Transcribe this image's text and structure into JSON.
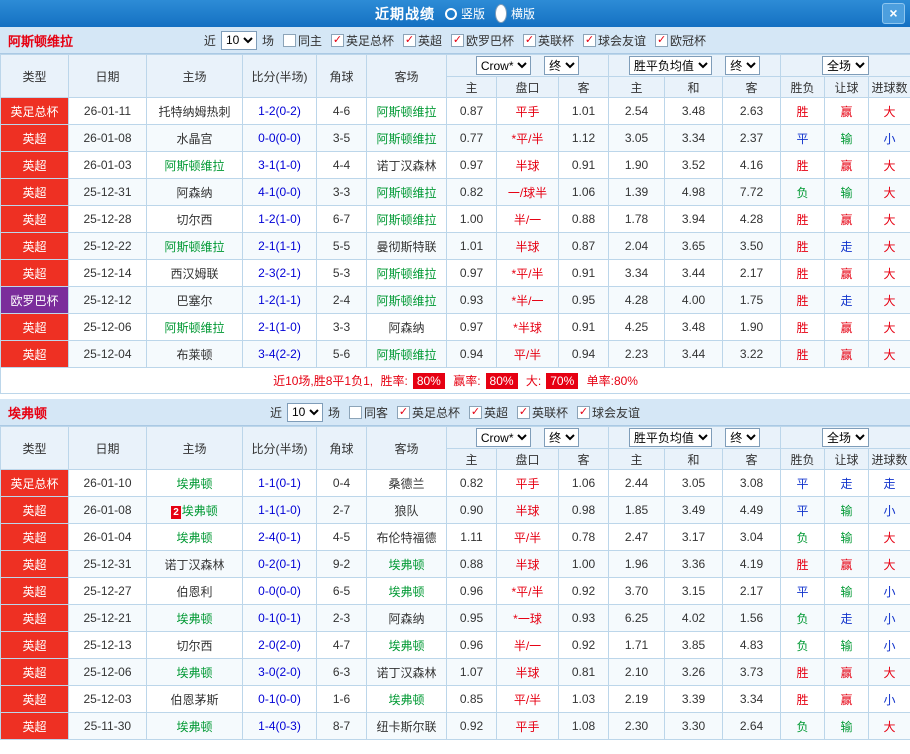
{
  "topbar": {
    "title": "近期战绩",
    "vertical": "竖版",
    "horizontal": "横版",
    "close": "×"
  },
  "controls": {
    "near": "近",
    "count": "10",
    "games": "场",
    "company": "Crow*",
    "final": "终",
    "avg": "胜平负均值",
    "scope": "全场"
  },
  "table_columns": {
    "type": "类型",
    "date": "日期",
    "home": "主场",
    "score": "比分(半场)",
    "corner": "角球",
    "away": "客场",
    "sub": [
      "主",
      "盘口",
      "客",
      "主",
      "和",
      "客",
      "胜负",
      "让球",
      "进球数"
    ]
  },
  "colors": {
    "topbar_blue": "#1470c2",
    "header_blue": "#d5e7f6",
    "accent_red": "#e60012"
  },
  "league_colors": {
    "英超": "#ee3023",
    "英足总杯": "#ee3023",
    "欧罗巴杯": "#7b2d9b"
  },
  "result_colors": {
    "胜": "#e60012",
    "平": "#1133cc",
    "负": "#009933",
    "赢": "#e60012",
    "输": "#009933",
    "走": "#1133cc",
    "大": "#e60012",
    "小": "#1133cc"
  },
  "sections": [
    {
      "team": "阿斯顿维拉",
      "filters": [
        {
          "label": "同主",
          "checked": false
        },
        {
          "label": "英足总杯",
          "checked": true
        },
        {
          "label": "英超",
          "checked": true
        },
        {
          "label": "欧罗巴杯",
          "checked": true
        },
        {
          "label": "英联杯",
          "checked": true
        },
        {
          "label": "球会友谊",
          "checked": true
        },
        {
          "label": "欧冠杯",
          "checked": true
        }
      ],
      "rows": [
        {
          "league": "英足总杯",
          "date": "26-01-11",
          "home": "托特纳姆热刺",
          "score": "1-2(0-2)",
          "corner": "4-6",
          "away": "阿斯顿维拉",
          "h": "0.87",
          "hcap": "平手",
          "a": "1.01",
          "avg_h": "2.54",
          "avg_d": "3.48",
          "avg_a": "2.63",
          "res": "胜",
          "hres": "赢",
          "gres": "大"
        },
        {
          "league": "英超",
          "date": "26-01-08",
          "home": "水晶宫",
          "score": "0-0(0-0)",
          "corner": "3-5",
          "away": "阿斯顿维拉",
          "h": "0.77",
          "hcap": "*平/半",
          "a": "1.12",
          "avg_h": "3.05",
          "avg_d": "3.34",
          "avg_a": "2.37",
          "res": "平",
          "hres": "输",
          "gres": "小"
        },
        {
          "league": "英超",
          "date": "26-01-03",
          "home": "阿斯顿维拉",
          "score": "3-1(1-0)",
          "corner": "4-4",
          "away": "诺丁汉森林",
          "h": "0.97",
          "hcap": "半球",
          "a": "0.91",
          "avg_h": "1.90",
          "avg_d": "3.52",
          "avg_a": "4.16",
          "res": "胜",
          "hres": "赢",
          "gres": "大"
        },
        {
          "league": "英超",
          "date": "25-12-31",
          "home": "阿森纳",
          "score": "4-1(0-0)",
          "corner": "3-3",
          "away": "阿斯顿维拉",
          "h": "0.82",
          "hcap": "一/球半",
          "a": "1.06",
          "avg_h": "1.39",
          "avg_d": "4.98",
          "avg_a": "7.72",
          "res": "负",
          "hres": "输",
          "gres": "大"
        },
        {
          "league": "英超",
          "date": "25-12-28",
          "home": "切尔西",
          "score": "1-2(1-0)",
          "corner": "6-7",
          "away": "阿斯顿维拉",
          "h": "1.00",
          "hcap": "半/一",
          "a": "0.88",
          "avg_h": "1.78",
          "avg_d": "3.94",
          "avg_a": "4.28",
          "res": "胜",
          "hres": "赢",
          "gres": "大"
        },
        {
          "league": "英超",
          "date": "25-12-22",
          "home": "阿斯顿维拉",
          "score": "2-1(1-1)",
          "corner": "5-5",
          "away": "曼彻斯特联",
          "h": "1.01",
          "hcap": "半球",
          "a": "0.87",
          "avg_h": "2.04",
          "avg_d": "3.65",
          "avg_a": "3.50",
          "res": "胜",
          "hres": "走",
          "gres": "大"
        },
        {
          "league": "英超",
          "date": "25-12-14",
          "home": "西汉姆联",
          "score": "2-3(2-1)",
          "corner": "5-3",
          "away": "阿斯顿维拉",
          "h": "0.97",
          "hcap": "*平/半",
          "a": "0.91",
          "avg_h": "3.34",
          "avg_d": "3.44",
          "avg_a": "2.17",
          "res": "胜",
          "hres": "赢",
          "gres": "大"
        },
        {
          "league": "欧罗巴杯",
          "date": "25-12-12",
          "home": "巴塞尔",
          "score": "1-2(1-1)",
          "corner": "2-4",
          "away": "阿斯顿维拉",
          "h": "0.93",
          "hcap": "*半/一",
          "a": "0.95",
          "avg_h": "4.28",
          "avg_d": "4.00",
          "avg_a": "1.75",
          "res": "胜",
          "hres": "走",
          "gres": "大"
        },
        {
          "league": "英超",
          "date": "25-12-06",
          "home": "阿斯顿维拉",
          "score": "2-1(1-0)",
          "corner": "3-3",
          "away": "阿森纳",
          "h": "0.97",
          "hcap": "*半球",
          "a": "0.91",
          "avg_h": "4.25",
          "avg_d": "3.48",
          "avg_a": "1.90",
          "res": "胜",
          "hres": "赢",
          "gres": "大"
        },
        {
          "league": "英超",
          "date": "25-12-04",
          "home": "布莱顿",
          "score": "3-4(2-2)",
          "corner": "5-6",
          "away": "阿斯顿维拉",
          "h": "0.94",
          "hcap": "平/半",
          "a": "0.94",
          "avg_h": "2.23",
          "avg_d": "3.44",
          "avg_a": "3.22",
          "res": "胜",
          "hres": "赢",
          "gres": "大"
        }
      ],
      "summary": {
        "prefix": "近10场,胜8平1负1,",
        "win_label": "胜率:",
        "win_rate": "80%",
        "cover_label": "赢率:",
        "cover_rate": "80%",
        "big_label": "大:",
        "big_rate": "70%",
        "single": "单率:80%"
      }
    },
    {
      "team": "埃弗顿",
      "filters": [
        {
          "label": "同客",
          "checked": false
        },
        {
          "label": "英足总杯",
          "checked": true
        },
        {
          "label": "英超",
          "checked": true
        },
        {
          "label": "英联杯",
          "checked": true
        },
        {
          "label": "球会友谊",
          "checked": true
        }
      ],
      "rows": [
        {
          "league": "英足总杯",
          "date": "26-01-10",
          "home": "埃弗顿",
          "score": "1-1(0-1)",
          "corner": "0-4",
          "away": "桑德兰",
          "h": "0.82",
          "hcap": "平手",
          "a": "1.06",
          "avg_h": "2.44",
          "avg_d": "3.05",
          "avg_a": "3.08",
          "res": "平",
          "hres": "走",
          "gres": "走"
        },
        {
          "league": "英超",
          "date": "26-01-08",
          "home": "埃弗顿",
          "home_card": "2",
          "score": "1-1(1-0)",
          "corner": "2-7",
          "away": "狼队",
          "h": "0.90",
          "hcap": "半球",
          "a": "0.98",
          "avg_h": "1.85",
          "avg_d": "3.49",
          "avg_a": "4.49",
          "res": "平",
          "hres": "输",
          "gres": "小"
        },
        {
          "league": "英超",
          "date": "26-01-04",
          "home": "埃弗顿",
          "score": "2-4(0-1)",
          "corner": "4-5",
          "away": "布伦特福德",
          "h": "1.11",
          "hcap": "平/半",
          "a": "0.78",
          "avg_h": "2.47",
          "avg_d": "3.17",
          "avg_a": "3.04",
          "res": "负",
          "hres": "输",
          "gres": "大"
        },
        {
          "league": "英超",
          "date": "25-12-31",
          "home": "诺丁汉森林",
          "score": "0-2(0-1)",
          "corner": "9-2",
          "away": "埃弗顿",
          "h": "0.88",
          "hcap": "半球",
          "a": "1.00",
          "avg_h": "1.96",
          "avg_d": "3.36",
          "avg_a": "4.19",
          "res": "胜",
          "hres": "赢",
          "gres": "大"
        },
        {
          "league": "英超",
          "date": "25-12-27",
          "home": "伯恩利",
          "score": "0-0(0-0)",
          "corner": "6-5",
          "away": "埃弗顿",
          "h": "0.96",
          "hcap": "*平/半",
          "a": "0.92",
          "avg_h": "3.70",
          "avg_d": "3.15",
          "avg_a": "2.17",
          "res": "平",
          "hres": "输",
          "gres": "小"
        },
        {
          "league": "英超",
          "date": "25-12-21",
          "home": "埃弗顿",
          "score": "0-1(0-1)",
          "corner": "2-3",
          "away": "阿森纳",
          "h": "0.95",
          "hcap": "*一球",
          "a": "0.93",
          "avg_h": "6.25",
          "avg_d": "4.02",
          "avg_a": "1.56",
          "res": "负",
          "hres": "走",
          "gres": "小"
        },
        {
          "league": "英超",
          "date": "25-12-13",
          "home": "切尔西",
          "score": "2-0(2-0)",
          "corner": "4-7",
          "away": "埃弗顿",
          "h": "0.96",
          "hcap": "半/一",
          "a": "0.92",
          "avg_h": "1.71",
          "avg_d": "3.85",
          "avg_a": "4.83",
          "res": "负",
          "hres": "输",
          "gres": "小"
        },
        {
          "league": "英超",
          "date": "25-12-06",
          "home": "埃弗顿",
          "score": "3-0(2-0)",
          "corner": "6-3",
          "away": "诺丁汉森林",
          "h": "1.07",
          "hcap": "半球",
          "a": "0.81",
          "avg_h": "2.10",
          "avg_d": "3.26",
          "avg_a": "3.73",
          "res": "胜",
          "hres": "赢",
          "gres": "大"
        },
        {
          "league": "英超",
          "date": "25-12-03",
          "home": "伯恩茅斯",
          "score": "0-1(0-0)",
          "corner": "1-6",
          "away": "埃弗顿",
          "h": "0.85",
          "hcap": "平/半",
          "a": "1.03",
          "avg_h": "2.19",
          "avg_d": "3.39",
          "avg_a": "3.34",
          "res": "胜",
          "hres": "赢",
          "gres": "小"
        },
        {
          "league": "英超",
          "date": "25-11-30",
          "home": "埃弗顿",
          "score": "1-4(0-3)",
          "corner": "8-7",
          "away": "纽卡斯尔联",
          "h": "0.92",
          "hcap": "平手",
          "a": "1.08",
          "avg_h": "2.30",
          "avg_d": "3.30",
          "avg_a": "2.64",
          "res": "负",
          "hres": "输",
          "gres": "大"
        }
      ]
    }
  ]
}
